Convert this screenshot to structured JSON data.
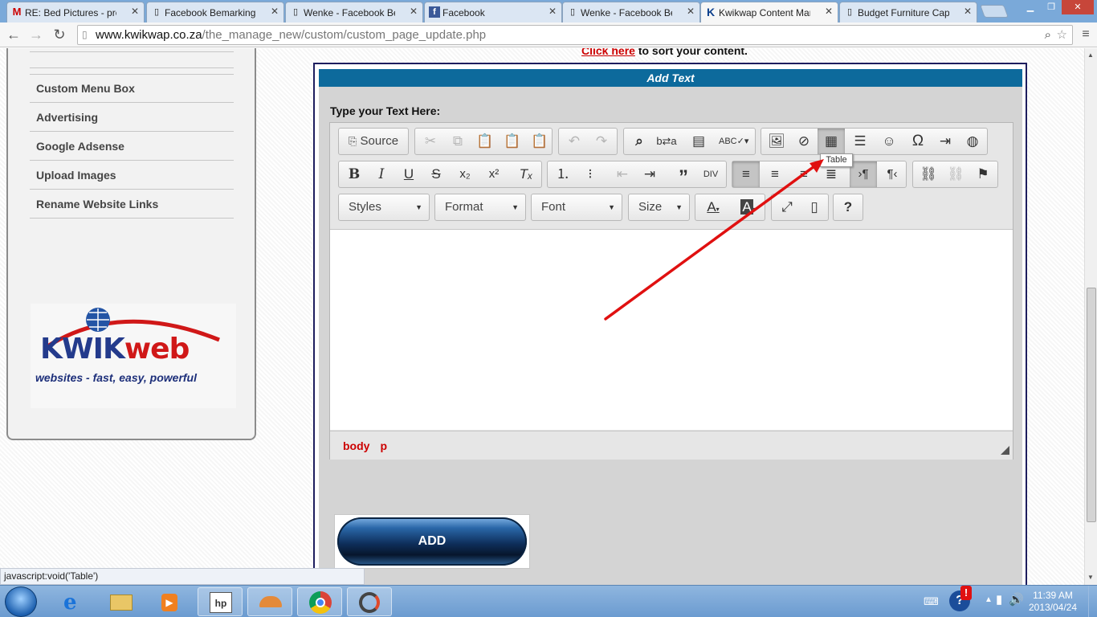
{
  "browser": {
    "tabs": [
      {
        "label": "RE: Bed Pictures - pretty",
        "icon": "gmail-icon"
      },
      {
        "label": "Facebook Bemarking S",
        "icon": "page-icon"
      },
      {
        "label": "Wenke - Facebook Ber",
        "icon": "page-icon"
      },
      {
        "label": "Facebook",
        "icon": "facebook-icon"
      },
      {
        "label": "Wenke - Facebook Ber",
        "icon": "page-icon"
      },
      {
        "label": "Kwikwap Content Mar",
        "icon": "kwikwap-icon"
      },
      {
        "label": "Budget Furniture Cape",
        "icon": "page-icon"
      }
    ],
    "url_host": "www.kwikwap.co.za",
    "url_path": "/the_manage_new/custom/custom_page_update.php",
    "status_text": "javascript:void('Table')"
  },
  "sidebar": {
    "items": [
      {
        "label": "Custom Menu Box"
      },
      {
        "label": "Advertising"
      },
      {
        "label": "Google Adsense"
      },
      {
        "label": "Upload Images"
      },
      {
        "label": "Rename Website Links"
      }
    ],
    "logo_word_kwik": "KWIK",
    "logo_word_web": "web",
    "logo_tagline": "websites - fast, easy, powerful"
  },
  "main": {
    "click_here": "Click here",
    "sort_text": " to sort your content.",
    "section_title": "Add Text",
    "type_label": "Type your Text Here:",
    "add_button": "ADD"
  },
  "editor": {
    "source_label": "Source",
    "combos": {
      "styles": "Styles",
      "format": "Format",
      "font": "Font",
      "size": "Size"
    },
    "tooltip": "Table",
    "path": [
      "body",
      "p"
    ]
  },
  "taskbar": {
    "time": "11:39 AM",
    "date": "2013/04/24"
  },
  "colors": {
    "section_header": "#0d6a9c",
    "link_red": "#cc0000",
    "annotation_arrow": "#e01010"
  }
}
